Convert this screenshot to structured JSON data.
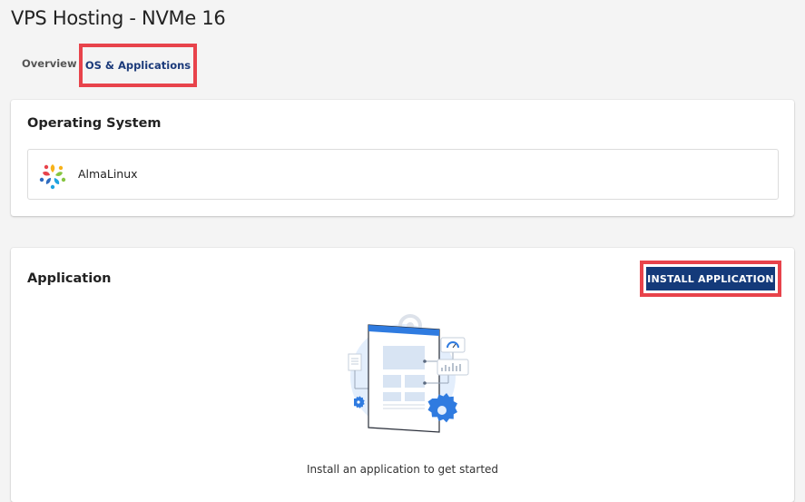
{
  "page": {
    "title": "VPS Hosting - NVMe 16"
  },
  "tabs": [
    {
      "label": "Overview",
      "active": false
    },
    {
      "label": "OS & Applications",
      "active": true
    }
  ],
  "os_section": {
    "title": "Operating System",
    "os_name": "AlmaLinux",
    "os_icon": "almalinux-logo-icon"
  },
  "app_section": {
    "title": "Application",
    "install_label": "INSTALL APPLICATION",
    "empty_message": "Install an application to get started",
    "illustration_icon": "install-application-illustration"
  },
  "colors": {
    "accent": "#143a7a",
    "highlight": "#e8434b",
    "illustration_blue": "#2f7be0"
  }
}
